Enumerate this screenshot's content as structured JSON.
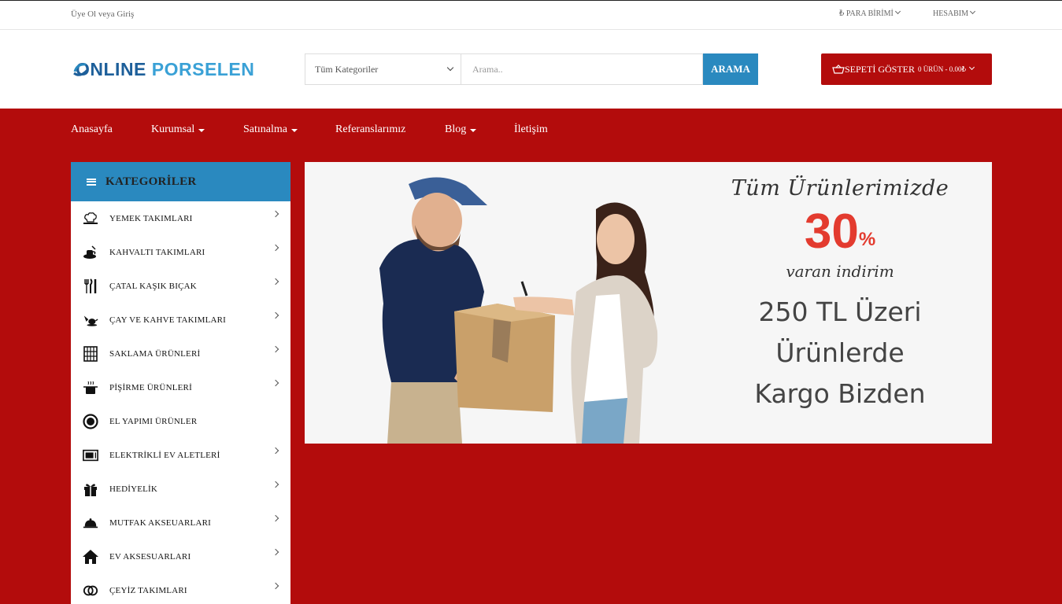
{
  "topbar": {
    "login_text": "Üye Ol veya Giriş",
    "currency_label": "₺ PARA BİRİMİ",
    "account_label": "HESABIM"
  },
  "logo": {
    "part1": "ONLINE",
    "part2": "PORSELEN"
  },
  "search": {
    "category_selected": "Tüm Kategoriler",
    "placeholder": "Arama..",
    "button_label": "ARAMA"
  },
  "cart": {
    "label": "SEPETİ GÖSTER",
    "summary": "0 ÜRÜN - 0.00₺"
  },
  "nav": {
    "items": [
      {
        "label": "Anasayfa"
      },
      {
        "label": "Kurumsal"
      },
      {
        "label": "Satınalma"
      },
      {
        "label": "Referanslarımız"
      },
      {
        "label": "Blog"
      },
      {
        "label": "İletişim"
      }
    ]
  },
  "sidebar": {
    "title": "KATEGORİLER",
    "items": [
      {
        "label": "YEMEK TAKIMLARI",
        "icon": "chef-hat-icon"
      },
      {
        "label": "KAHVALTI TAKIMLARI",
        "icon": "breakfast-icon"
      },
      {
        "label": "ÇATAL KAŞIK BIÇAK",
        "icon": "cutlery-icon"
      },
      {
        "label": "ÇAY VE KAHVE TAKIMLARI",
        "icon": "teapot-icon"
      },
      {
        "label": "SAKLAMA ÜRÜNLERİ",
        "icon": "storage-icon"
      },
      {
        "label": "PİŞİRME ÜRÜNLERİ",
        "icon": "cooking-pot-icon"
      },
      {
        "label": "EL YAPIMI ÜRÜNLER",
        "icon": "handmade-icon"
      },
      {
        "label": "ELEKTRİKLİ EV ALETLERİ",
        "icon": "microwave-icon"
      },
      {
        "label": "HEDİYELİK",
        "icon": "gift-icon"
      },
      {
        "label": "MUTFAK AKSEUARLARI",
        "icon": "cloche-icon"
      },
      {
        "label": "EV AKSESUARLARI",
        "icon": "house-icon"
      },
      {
        "label": "ÇEYİZ TAKIMLARI",
        "icon": "rings-icon"
      }
    ]
  },
  "banner": {
    "script_line": "Tüm Ürünlerimizde",
    "percent": "30",
    "percent_sign": "%",
    "sub_line": "varan indirim",
    "line1": "250 TL Üzeri Ürünlerde",
    "line2": "Kargo Bizden"
  },
  "colors": {
    "brand_red": "#b30c0c",
    "accent_blue": "#2a89bf",
    "promo_red": "#e33b2f"
  }
}
